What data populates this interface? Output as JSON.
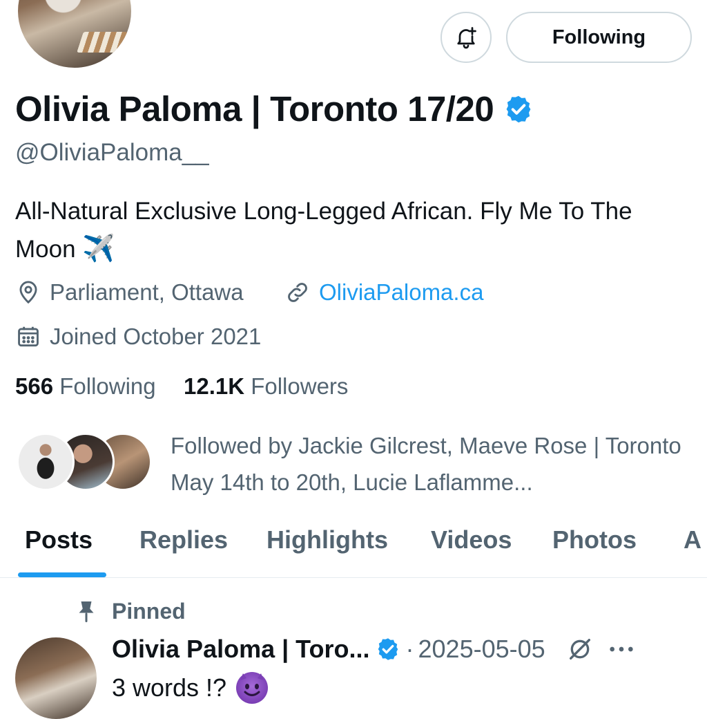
{
  "header": {
    "following_button": "Following",
    "notify_icon": "bell-plus-icon"
  },
  "profile": {
    "display_name": "Olivia Paloma | Toronto 17/20",
    "verified": true,
    "handle": "@OliviaPaloma__",
    "bio": "All-Natural Exclusive Long-Legged African. Fly Me To The Moon",
    "bio_emoji": "✈️",
    "location": "Parliament, Ottawa",
    "website": "OliviaPaloma.ca",
    "joined": "Joined October 2021",
    "following_count": "566",
    "following_label": "Following",
    "followers_count": "12.1K",
    "followers_label": "Followers",
    "followed_by": "Followed by Jackie Gilcrest, Maeve Rose | Toronto May 14th to 20th, Lucie Laflamme..."
  },
  "tabs": [
    {
      "label": "Posts",
      "active": true
    },
    {
      "label": "Replies",
      "active": false
    },
    {
      "label": "Highlights",
      "active": false
    },
    {
      "label": "Videos",
      "active": false
    },
    {
      "label": "Photos",
      "active": false
    },
    {
      "label": "A",
      "active": false
    }
  ],
  "pinned_post": {
    "pinned_label": "Pinned",
    "author": "Olivia Paloma | Toro...",
    "date": "2025-05-05",
    "text": "3 words !?",
    "emoji": "smiling-devil"
  },
  "colors": {
    "accent": "#1d9bf0",
    "text_primary": "#0f1419",
    "text_secondary": "#536471"
  }
}
